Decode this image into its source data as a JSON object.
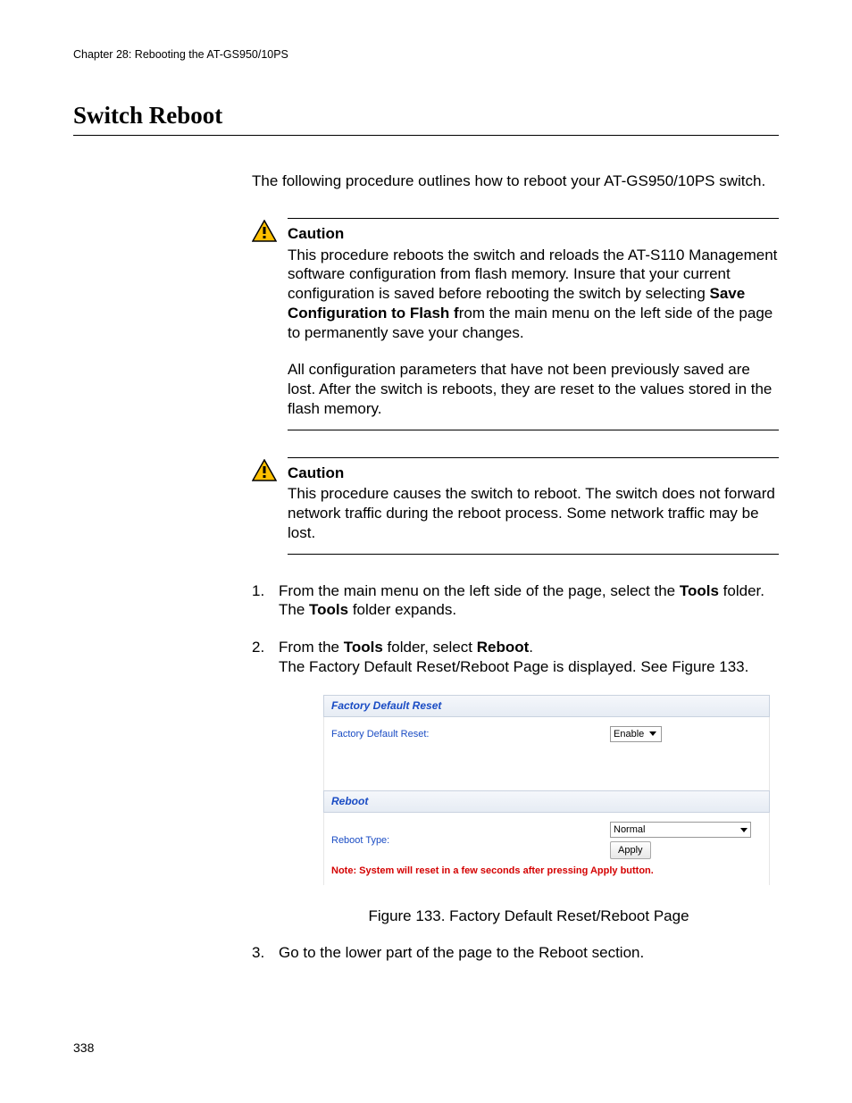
{
  "chapter_header": "Chapter 28: Rebooting the AT-GS950/10PS",
  "section_title": "Switch Reboot",
  "intro": "The following procedure outlines how to reboot your AT-GS950/10PS switch.",
  "caution1": {
    "title": "Caution",
    "p1_a": "This procedure reboots the switch and reloads the AT-S110 Management software configuration from flash memory. Insure that your current configuration is saved before rebooting the switch by selecting ",
    "p1_bold": "Save Configuration to Flash f",
    "p1_b": "rom the main menu on the left side of the page to permanently save your changes.",
    "p2": "All configuration parameters that have not been previously saved are lost. After the switch is reboots, they are reset to the values stored in the flash memory."
  },
  "caution2": {
    "title": "Caution",
    "text": "This procedure causes the switch to reboot. The switch does not forward network traffic during the reboot process. Some network traffic may be lost."
  },
  "steps": {
    "s1": {
      "num": "1.",
      "a": "From the main menu on the left side of the page, select the ",
      "bold1": "Tools",
      "b": " folder.",
      "line2a": "The ",
      "line2bold": "Tools",
      "line2b": " folder expands."
    },
    "s2": {
      "num": "2.",
      "a": "From the ",
      "bold1": "Tools",
      "b": " folder, select ",
      "bold2": "Reboot",
      "c": ".",
      "line2": "The Factory Default Reset/Reboot Page is displayed. See Figure 133."
    },
    "s3": {
      "num": "3.",
      "text": "Go to the lower part of the page to the Reboot section."
    }
  },
  "figure": {
    "panel1_title": "Factory Default Reset",
    "panel1_label": "Factory Default Reset:",
    "panel1_value": "Enable",
    "panel2_title": "Reboot",
    "panel2_label": "Reboot Type:",
    "panel2_value": "Normal",
    "apply": "Apply",
    "note": "Note: System will reset in a few seconds after pressing Apply button.",
    "caption": "Figure 133. Factory Default Reset/Reboot Page"
  },
  "page_number": "338"
}
